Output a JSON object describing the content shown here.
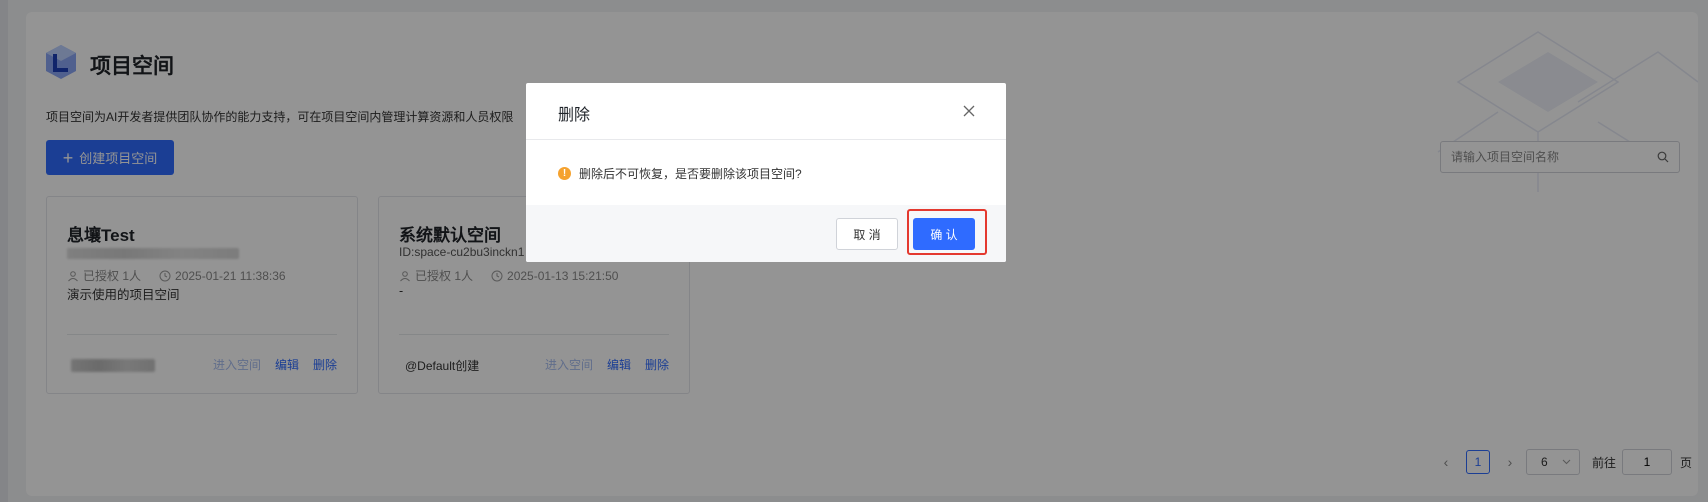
{
  "header": {
    "title": "项目空间",
    "description": "项目空间为AI开发者提供团队协作的能力支持，可在项目空间内管理计算资源和人员权限",
    "create_button": "创建项目空间"
  },
  "search": {
    "placeholder": "请输入项目空间名称"
  },
  "cards": [
    {
      "name": "息壤Test",
      "authorized": "已授权 1人",
      "time": "2025-01-21 11:38:36",
      "desc": "演示使用的项目空间",
      "actions": {
        "enter": "进入空间",
        "edit": "编辑",
        "delete": "删除"
      }
    },
    {
      "name": "系统默认空间",
      "id": "ID:space-cu2bu3inckn1",
      "authorized": "已授权 1人",
      "time": "2025-01-13 15:21:50",
      "desc": "-",
      "owner": "@Default创建",
      "actions": {
        "enter": "进入空间",
        "edit": "编辑",
        "delete": "删除"
      }
    }
  ],
  "pagination": {
    "current": "1",
    "page_size": "6",
    "goto_label": "前往",
    "goto_value": "1",
    "page_unit": "页"
  },
  "dialog": {
    "title": "删除",
    "message": "删除后不可恢复，是否要删除该项目空间?",
    "cancel": "取 消",
    "confirm": "确 认"
  },
  "colors": {
    "primary": "#2f6bff",
    "warning": "#f5a22f",
    "highlight": "#e4392f"
  }
}
